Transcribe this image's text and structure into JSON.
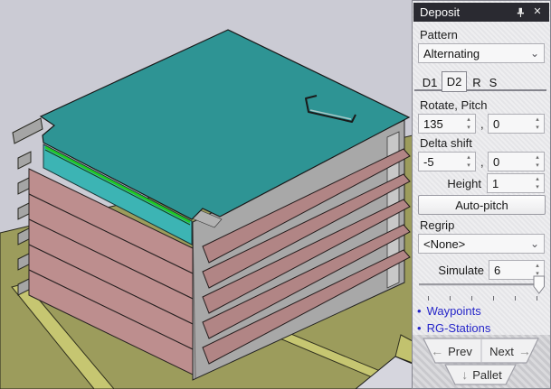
{
  "scene": {
    "background_color": "#cbcbd4",
    "floor": {
      "color": "#9c9c5c",
      "stripe_color": "#c6c671",
      "wall_color": "#d6d6de"
    },
    "stack": {
      "top_sheet_color": "#2e9494",
      "fold_color": "#3cb4b4",
      "fold_line_color": "#22c822",
      "pink_sheet_color": "#bd8e8e",
      "pink_wedge_color": "#b18585",
      "gray_sheet_color": "#a8a8a8",
      "pink_layer_count": 5,
      "gray_flap_count": 6
    }
  },
  "panel": {
    "title": "Deposit",
    "header_bg": "#2a2a31",
    "pattern_label": "Pattern",
    "pattern_value": "Alternating",
    "tabs": [
      {
        "label": "D1",
        "selected": false
      },
      {
        "label": "D2",
        "selected": true
      },
      {
        "label": "R",
        "selected": false
      },
      {
        "label": "S",
        "selected": false
      }
    ],
    "rotate_pitch": {
      "label": "Rotate, Pitch",
      "rotate": "135",
      "separator": ",",
      "pitch": "0"
    },
    "delta_shift": {
      "label": "Delta shift",
      "dx": "-5",
      "separator": ",",
      "dy": "0"
    },
    "height": {
      "label": "Height",
      "value": "1"
    },
    "auto_pitch_label": "Auto-pitch",
    "regrip_label": "Regrip",
    "regrip_value": "<None>",
    "simulate": {
      "label": "Simulate",
      "value": "6"
    },
    "links": [
      {
        "label": "Waypoints"
      },
      {
        "label": "RG-Stations"
      }
    ],
    "nav": {
      "prev": "Prev",
      "next": "Next",
      "pallet": "Pallet"
    },
    "link_color": "#2626c9"
  },
  "icons": {
    "close": "✕",
    "chevron": "⌄",
    "spin_up": "▴",
    "spin_down": "▾",
    "arrow_left": "←",
    "arrow_right": "→",
    "arrow_down": "↓",
    "bullet": "•"
  }
}
